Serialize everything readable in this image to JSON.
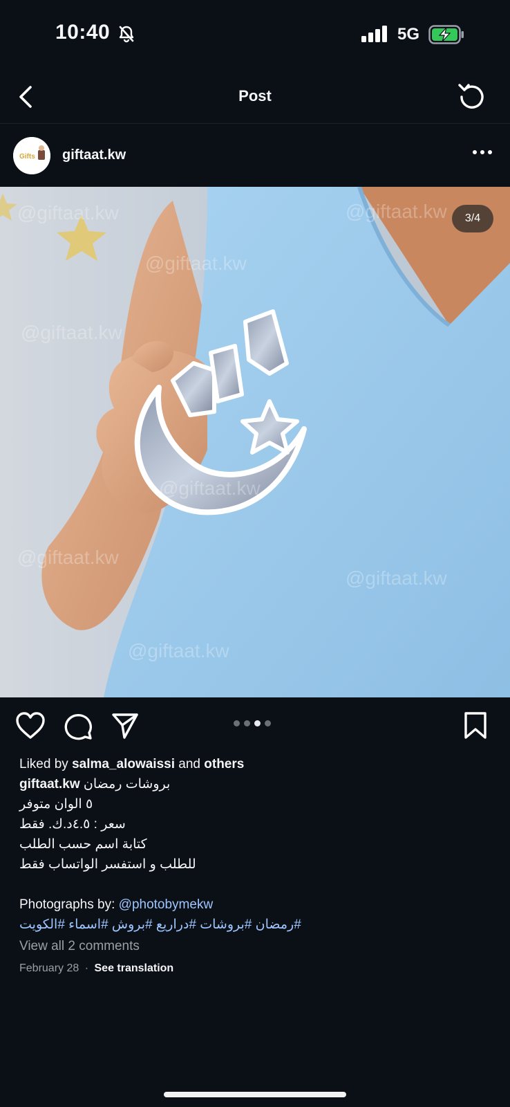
{
  "status_bar": {
    "time": "10:40",
    "network": "5G",
    "battery_state": "charging"
  },
  "nav": {
    "title": "Post"
  },
  "post": {
    "username": "giftaat.kw",
    "avatar_text": "Gifts",
    "image_counter": "3/4",
    "watermark": "@giftaat.kw",
    "current_slide": 3,
    "total_slides": 4
  },
  "caption": {
    "liked_prefix": "Liked by",
    "liked_user": "salma_alowaissi",
    "liked_and": "and",
    "liked_others": "others",
    "author": "giftaat.kw",
    "lines": [
      "بروشات رمضان",
      "٥ الوان متوفر",
      "سعر : ٤.٥د.ك. فقط",
      "كتابة اسم حسب الطلب",
      "للطلب و استفسر الواتساب فقط"
    ],
    "photographs_prefix": "Photographs by:",
    "photographer": "@photobymekw",
    "hashtags": "#رمضان #بروشات #دراريع #بروش #اسماء #الكويت",
    "view_comments": "View all 2 comments",
    "date": "February 28",
    "separator": "·",
    "see_translation": "See translation"
  },
  "colors": {
    "background": "#0b0f16",
    "link": "#9ec6ff",
    "muted": "#9aa0aa",
    "shirt": "#9fc8ea",
    "battery": "#34c759"
  }
}
